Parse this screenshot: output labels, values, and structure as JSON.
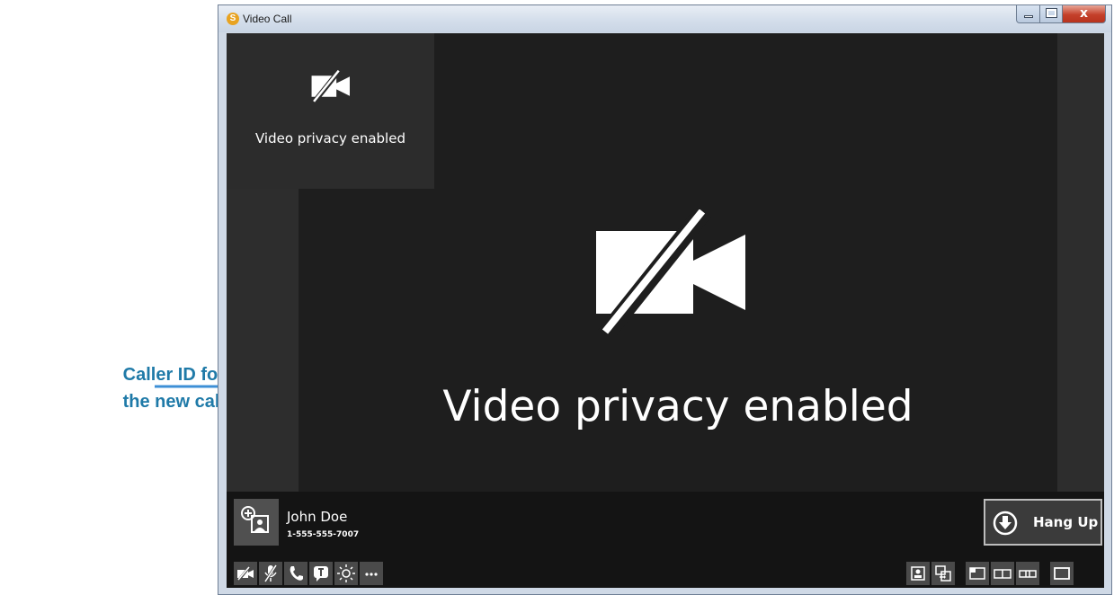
{
  "annotation": {
    "line1": "Caller ID for",
    "line2": "the new call"
  },
  "window": {
    "title": "Video Call",
    "app_icon_letter": "S",
    "close_glyph": "x"
  },
  "self_view": {
    "status_text": "Video privacy enabled",
    "icon": "video-off-icon"
  },
  "remote_view": {
    "status_text": "Video privacy enabled",
    "icon": "video-off-icon"
  },
  "caller": {
    "name": "John Doe",
    "number": "1-555-555-7007",
    "icon": "add-contact-icon"
  },
  "hang_up": {
    "label": "Hang Up",
    "icon": "hang-up-icon"
  },
  "toolbar_left": [
    {
      "icon": "video-privacy-icon"
    },
    {
      "icon": "mute-microphone-icon"
    },
    {
      "icon": "phone-icon"
    },
    {
      "icon": "chat-icon"
    },
    {
      "icon": "brightness-icon"
    },
    {
      "icon": "more-icon"
    }
  ],
  "toolbar_right": [
    {
      "icon": "contact-card-icon"
    },
    {
      "icon": "share-screen-icon"
    },
    {
      "icon": "layout-pip-icon"
    },
    {
      "icon": "layout-side-by-side-icon"
    },
    {
      "icon": "layout-small-icon"
    },
    {
      "icon": "layout-fullscreen-icon"
    }
  ],
  "colors": {
    "annotation": "#1f7aa8",
    "arrow": "#3d8fd6",
    "video_bg": "#1e1e1e",
    "bottom_bar": "#141414"
  }
}
